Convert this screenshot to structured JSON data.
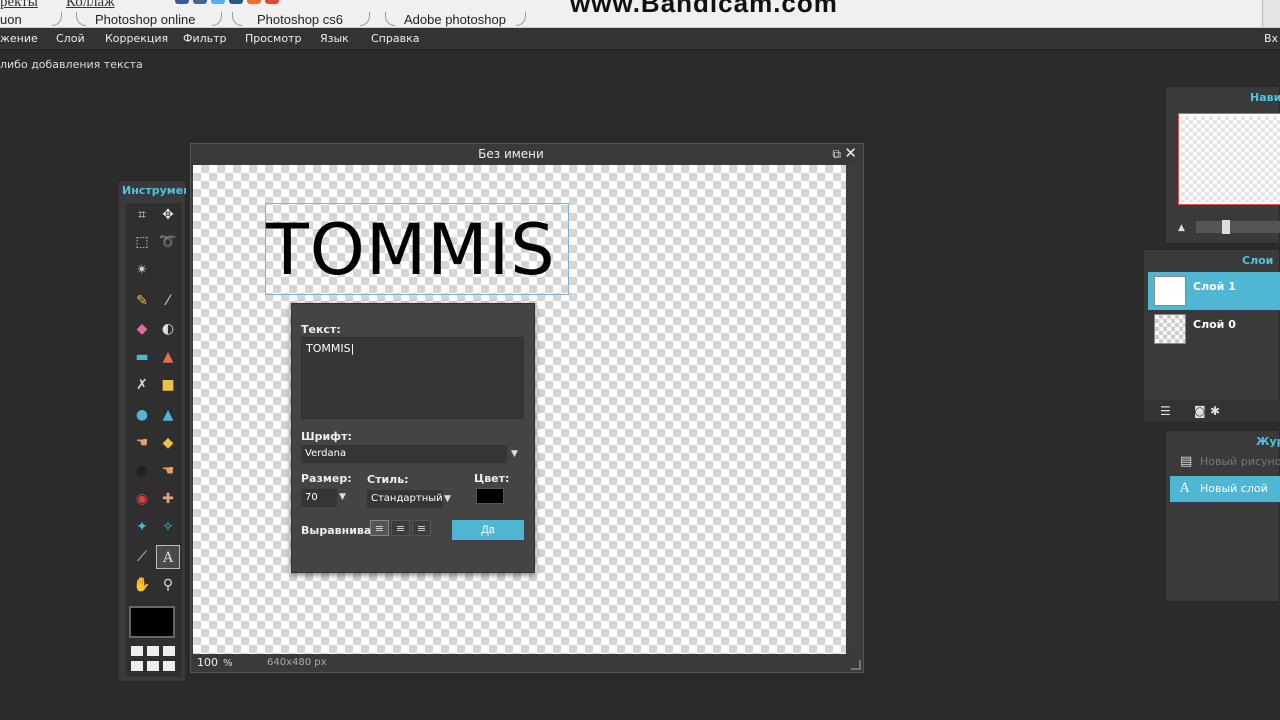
{
  "browser": {
    "top_links": [
      "ректы",
      "Коллаж"
    ],
    "bookmarks": [
      "uon",
      "Photoshop online",
      "Photoshop cs6",
      "Adobe photoshop"
    ],
    "watermark": "www.Bandicam.com"
  },
  "menubar": {
    "items": [
      "жение",
      "Слой",
      "Коррекция",
      "Фильтр",
      "Просмотр",
      "Язык",
      "Справка"
    ],
    "login": "Вх"
  },
  "status_hint": "либо добавления текста",
  "tools_panel": {
    "title": "Инструмент",
    "foreground_color": "#000000",
    "tools": [
      "crop-icon",
      "move-icon",
      "marquee-icon",
      "lasso-icon",
      "magic-wand-icon",
      "pencil-icon",
      "brush-icon",
      "eraser-icon",
      "paint-bucket-icon",
      "gradient-icon",
      "clone-stamp-icon",
      "color-replace-icon",
      "shape-icon",
      "blur-icon",
      "sharpen-icon",
      "smudge-icon",
      "sponge-icon",
      "dodge-icon",
      "burn-icon",
      "red-eye-icon",
      "spot-heal-icon",
      "bloat-icon",
      "pinch-icon",
      "eyedropper-icon",
      "text-icon",
      "hand-icon",
      "zoom-icon"
    ]
  },
  "document": {
    "title": "Без имени",
    "canvas_text": "TOMMIS",
    "zoom": "100",
    "zoom_unit": "%",
    "size": "640x480 px"
  },
  "text_dialog": {
    "text_label": "Текст:",
    "text_value": "TOMMIS",
    "font_label": "Шрифт:",
    "font_value": "Verdana",
    "size_label": "Размер:",
    "size_value": "70",
    "style_label": "Стиль:",
    "style_value": "Стандартный",
    "color_label": "Цвет:",
    "color_value": "#000000",
    "align_label": "Выравнивание:",
    "ok_label": "Да"
  },
  "navigator_panel": {
    "title": "Навиг"
  },
  "layers_panel": {
    "title": "Слои",
    "layers": [
      {
        "name": "Слой 1",
        "selected": true
      },
      {
        "name": "Слой 0",
        "selected": false
      }
    ]
  },
  "history_panel": {
    "title": "Жур",
    "items": [
      {
        "name": "Новый рисунок",
        "icon": "document-icon",
        "selected": false
      },
      {
        "name": "Новый слой",
        "icon": "text-layer-icon",
        "selected": true
      }
    ]
  },
  "colors": {
    "accent": "#4fb7d3",
    "panel_title": "#4fc3e0",
    "background": "#2b2b2b"
  }
}
